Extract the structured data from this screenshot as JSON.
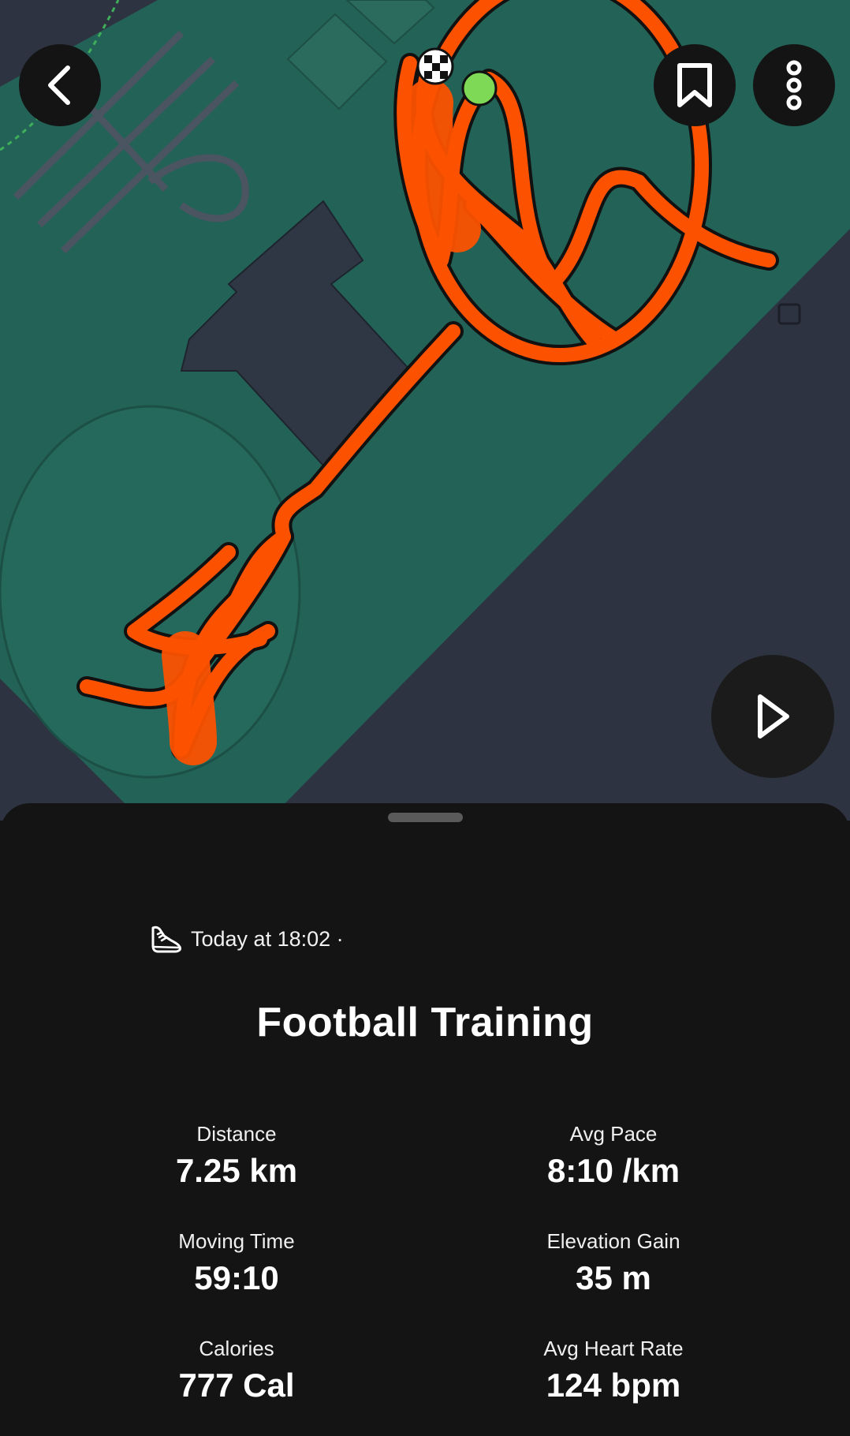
{
  "map": {
    "route_color": "#fc5200",
    "park_color": "#236256",
    "ground_color": "#2d3340",
    "building_color": "#2f3745",
    "start_marker": "green-dot",
    "finish_marker": "checkered-flag"
  },
  "toolbar": {
    "back_icon": "chevron-left-icon",
    "bookmark_icon": "bookmark-icon",
    "more_icon": "vertical-dots-icon",
    "play_icon": "play-icon"
  },
  "activity": {
    "icon": "running-shoe-icon",
    "timestamp": "Today at 18:02 ·",
    "title": "Football Training"
  },
  "stats": [
    {
      "label": "Distance",
      "value": "7.25 km"
    },
    {
      "label": "Avg Pace",
      "value": "8:10 /km"
    },
    {
      "label": "Moving Time",
      "value": "59:10"
    },
    {
      "label": "Elevation Gain",
      "value": "35 m"
    },
    {
      "label": "Calories",
      "value": "777 Cal"
    },
    {
      "label": "Avg Heart Rate",
      "value": "124 bpm"
    }
  ]
}
